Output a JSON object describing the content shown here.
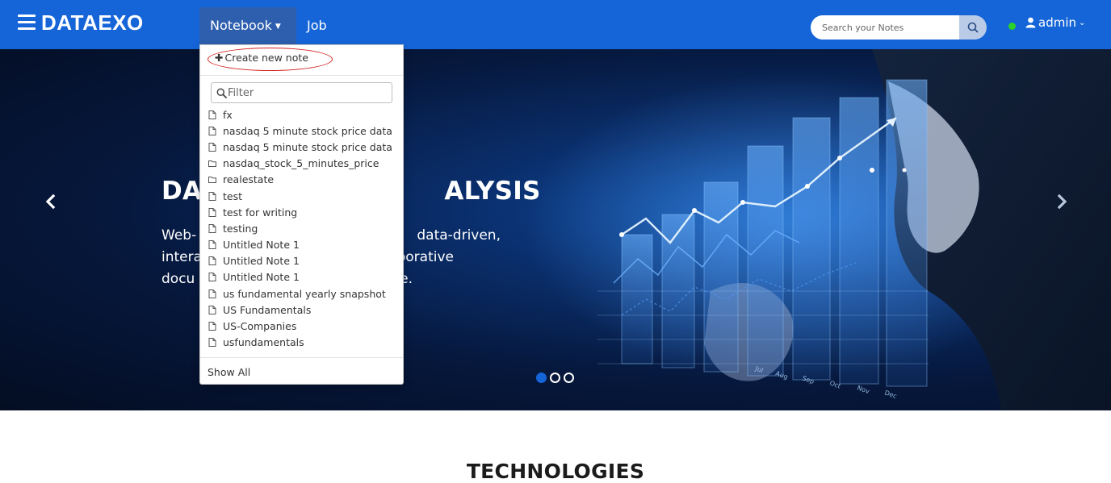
{
  "navbar": {
    "brand": "DATAEXO",
    "menu_icon": "hamburger-menu-icon",
    "notebook_label": "Notebook",
    "job_label": "Job",
    "search_placeholder": "Search your Notes",
    "search_icon": "search-icon",
    "user_label": "admin",
    "user_icon": "user-icon",
    "status_color": "#2ad22a",
    "color": "#1565d8"
  },
  "hero": {
    "title_visible_left": "DA",
    "title_visible_right": "ALYSIS",
    "text_lines_left": [
      "Web-",
      "intera",
      "docu"
    ],
    "text_lines_right": [
      "data-driven,",
      "borative",
      "e."
    ],
    "prev_icon": "chevron-left-icon",
    "next_icon": "chevron-right-icon",
    "indicator_count": 3,
    "active_indicator": 0,
    "chart_months": [
      "Jul",
      "Aug",
      "Sep",
      "Oct",
      "Nov",
      "Dec"
    ]
  },
  "dropdown": {
    "create_label": "Create new note",
    "filter_placeholder": "Filter",
    "items": [
      {
        "label": "fx",
        "icon": "file-icon"
      },
      {
        "label": "nasdaq 5 minute stock price data",
        "icon": "file-icon"
      },
      {
        "label": "nasdaq 5 minute stock price data",
        "icon": "file-icon"
      },
      {
        "label": "nasdaq_stock_5_minutes_price",
        "icon": "folder-icon"
      },
      {
        "label": "realestate",
        "icon": "folder-icon"
      },
      {
        "label": "test",
        "icon": "file-icon"
      },
      {
        "label": "test for writing",
        "icon": "file-icon"
      },
      {
        "label": "testing",
        "icon": "file-icon"
      },
      {
        "label": "Untitled Note 1",
        "icon": "file-icon"
      },
      {
        "label": "Untitled Note 1",
        "icon": "file-icon"
      },
      {
        "label": "Untitled Note 1",
        "icon": "file-icon"
      },
      {
        "label": "us fundamental yearly snapshot",
        "icon": "file-icon"
      },
      {
        "label": "US Fundamentals",
        "icon": "file-icon"
      },
      {
        "label": "US-Companies",
        "icon": "file-icon"
      },
      {
        "label": "usfundamentals",
        "icon": "file-icon"
      }
    ],
    "show_all_label": "Show All"
  },
  "section": {
    "title": "TECHNOLOGIES"
  }
}
